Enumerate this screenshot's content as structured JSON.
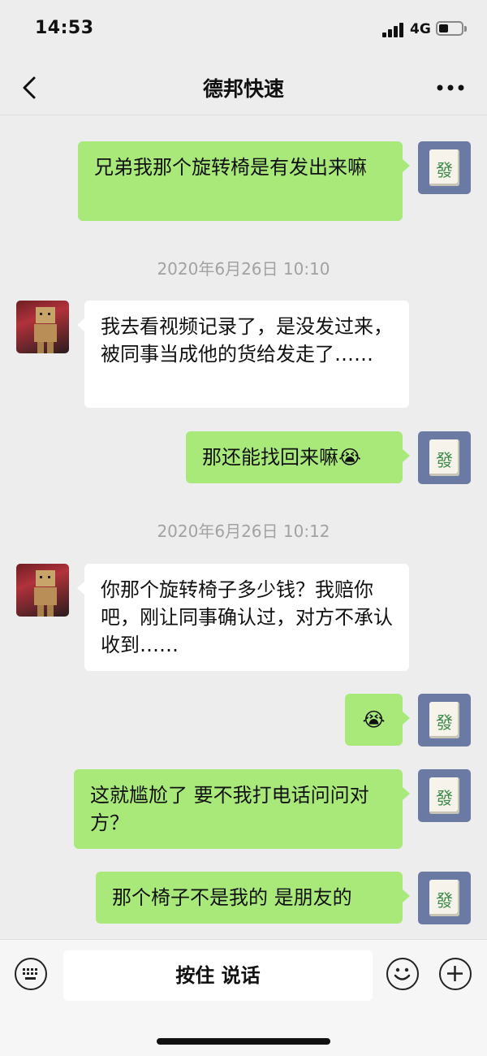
{
  "status_bar": {
    "time": "14:53",
    "network": "4G"
  },
  "header": {
    "title": "德邦快速"
  },
  "messages": [
    {
      "side": "sent",
      "text": "兄弟我那个旋转椅是有发出来嘛"
    },
    {
      "type": "timestamp",
      "text": "2020年6月26日 10:10"
    },
    {
      "side": "received",
      "text": "我去看视频记录了，是没发过来，被同事当成他的货给发走了……"
    },
    {
      "side": "sent",
      "text": "那还能找回来嘛",
      "emoji": "😭"
    },
    {
      "type": "timestamp",
      "text": "2020年6月26日 10:12"
    },
    {
      "side": "received",
      "text": "你那个旋转椅子多少钱？我赔你吧，刚让同事确认过，对方不承认收到……"
    },
    {
      "side": "sent",
      "text": "",
      "emoji": "😭"
    },
    {
      "side": "sent",
      "text": "这就尴尬了 要不我打电话问问对方？"
    },
    {
      "side": "sent",
      "text": "那个椅子不是我的 是朋友的"
    }
  ],
  "avatars": {
    "me_glyph": "發"
  },
  "input_bar": {
    "hold_to_talk": "按住 说话"
  },
  "icons": [
    "back-icon",
    "more-icon",
    "keyboard-icon",
    "emoji-icon",
    "plus-icon"
  ],
  "colors": {
    "sent_bubble": "#a9e97a",
    "received_bubble": "#ffffff",
    "background": "#ededed"
  }
}
